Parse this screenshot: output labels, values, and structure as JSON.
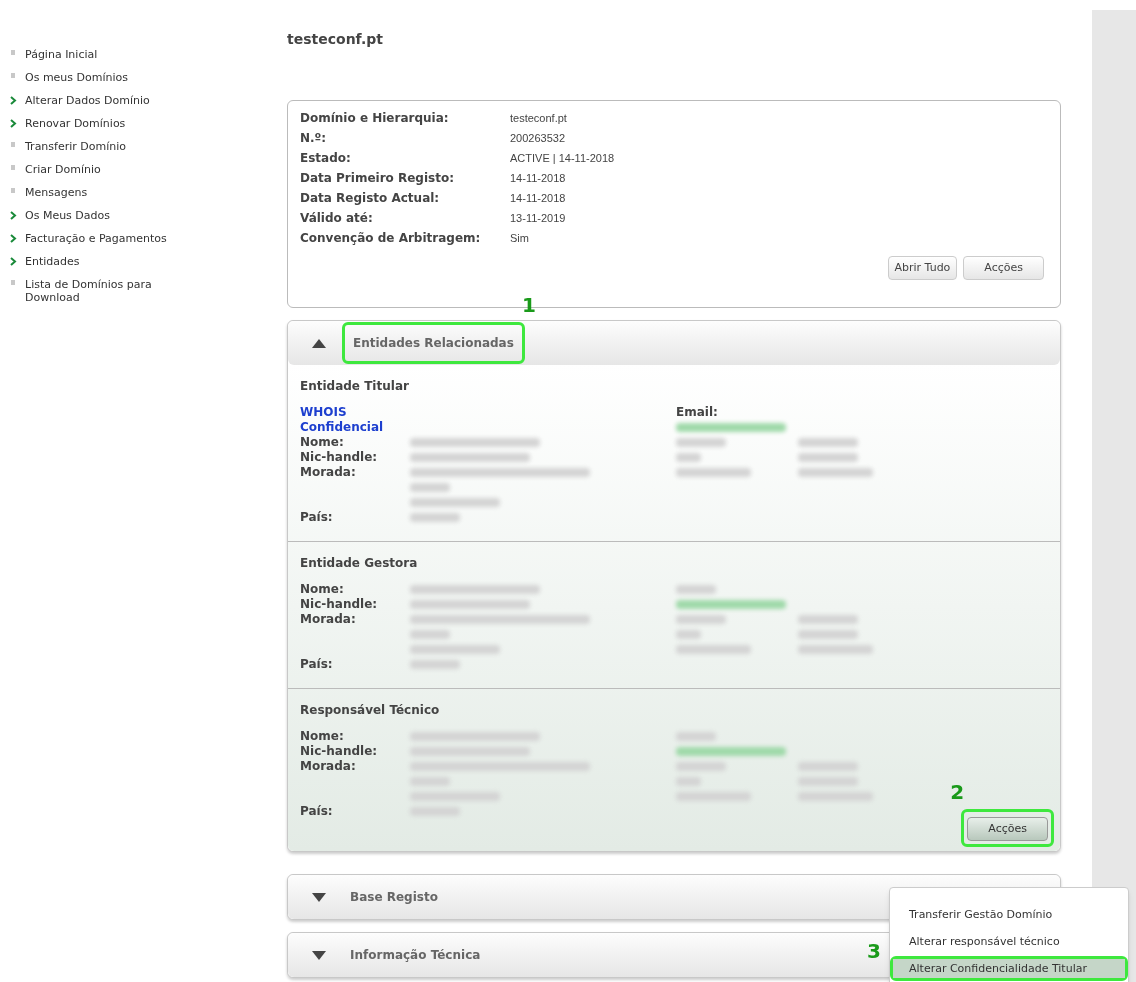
{
  "sidebar": {
    "items": [
      {
        "label": "Página Inicial",
        "kind": "dot"
      },
      {
        "label": "Os meus Domínios",
        "kind": "dot"
      },
      {
        "label": "Alterar Dados Domínio",
        "kind": "arrow"
      },
      {
        "label": "Renovar Domínios",
        "kind": "arrow"
      },
      {
        "label": "Transferir Domínio",
        "kind": "dot"
      },
      {
        "label": "Criar Domínio",
        "kind": "dot"
      },
      {
        "label": "Mensagens",
        "kind": "dot"
      },
      {
        "label": "Os Meus Dados",
        "kind": "arrow"
      },
      {
        "label": "Facturação e Pagamentos",
        "kind": "arrow"
      },
      {
        "label": "Entidades",
        "kind": "arrow"
      },
      {
        "label": "Lista de Domínios para Download",
        "kind": "dot"
      }
    ]
  },
  "page_title": "testeconf.pt",
  "summary": {
    "rows": [
      {
        "label": "Domínio e Hierarquia:",
        "value": "testeconf.pt"
      },
      {
        "label": "N.º:",
        "value": "200263532"
      },
      {
        "label": "Estado:",
        "value": "ACTIVE | 14-11-2018"
      },
      {
        "label": "Data Primeiro Registo:",
        "value": "14-11-2018"
      },
      {
        "label": "Data Registo Actual:",
        "value": "14-11-2018"
      },
      {
        "label": "Válido até:",
        "value": "13-11-2019"
      },
      {
        "label": "Convenção de Arbitragem:",
        "value": "Sim"
      }
    ],
    "buttons": [
      "Abrir Tudo",
      "Acções"
    ]
  },
  "panels": [
    {
      "title": "Entidades Relacionadas",
      "expanded": true,
      "annotation": "1",
      "entities": [
        {
          "title": "Entidade Titular",
          "whois": "WHOIS\nConfidencial",
          "email_label": "Email:",
          "labels": [
            "Nome:",
            "Nic-handle:",
            "Morada:",
            "País:"
          ]
        },
        {
          "title": "Entidade Gestora",
          "labels": [
            "Nome:",
            "Nic-handle:",
            "Morada:",
            "País:"
          ]
        },
        {
          "title": "Responsável Técnico",
          "labels": [
            "Nome:",
            "Nic-handle:",
            "Morada:",
            "País:"
          ]
        }
      ],
      "actions": {
        "label": "Acções",
        "annotation": "2"
      }
    },
    {
      "title": "Base Registo",
      "expanded": false
    },
    {
      "title": "Informação Técnica",
      "expanded": false
    }
  ],
  "menu": {
    "items": [
      {
        "label": "Transferir Gestão Domínio",
        "selected": false
      },
      {
        "label": "Alterar responsável técnico",
        "selected": false
      },
      {
        "label": "Alterar Confidencialidade Titular",
        "selected": true,
        "annotation": "3"
      }
    ]
  }
}
